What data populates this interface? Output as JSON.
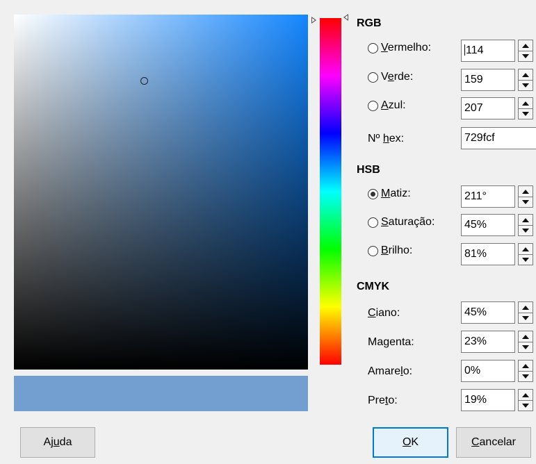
{
  "color": {
    "current_hex": "#729fcf",
    "field_base_hue_hex": "#1486ff",
    "saturation_fraction": 0.45,
    "brightness_fraction": 0.81,
    "hue_degrees": 211
  },
  "rgb": {
    "heading": "RGB",
    "rows": [
      {
        "label_prefix": "",
        "label_access": "V",
        "label_rest": "ermelho:",
        "value": "114",
        "selected": false
      },
      {
        "label_prefix": "V",
        "label_access": "e",
        "label_rest": "rde:",
        "value": "159",
        "selected": false
      },
      {
        "label_prefix": "",
        "label_access": "A",
        "label_rest": "zul:",
        "value": "207",
        "selected": false
      }
    ],
    "hex": {
      "label_prefix": "Nº ",
      "label_access": "h",
      "label_rest": "ex:",
      "value": "729fcf"
    }
  },
  "hsb": {
    "heading": "HSB",
    "rows": [
      {
        "label_prefix": "",
        "label_access": "M",
        "label_rest": "atiz:",
        "value": "211°",
        "selected": true
      },
      {
        "label_prefix": "",
        "label_access": "S",
        "label_rest": "aturação:",
        "value": "45%",
        "selected": false
      },
      {
        "label_prefix": "",
        "label_access": "B",
        "label_rest": "rilho:",
        "value": "81%",
        "selected": false
      }
    ]
  },
  "cmyk": {
    "heading": "CMYK",
    "rows": [
      {
        "label_prefix": "",
        "label_access": "C",
        "label_rest": "iano:",
        "value": "45%"
      },
      {
        "label_prefix": "Ma",
        "label_access": "g",
        "label_rest": "enta:",
        "value": "23%"
      },
      {
        "label_prefix": "Amare",
        "label_access": "l",
        "label_rest": "o:",
        "value": "0%"
      },
      {
        "label_prefix": "Pre",
        "label_access": "t",
        "label_rest": "o:",
        "value": "19%"
      }
    ]
  },
  "buttons": {
    "help": {
      "prefix": "Aj",
      "access": "u",
      "rest": "da"
    },
    "ok": {
      "prefix": "",
      "access": "O",
      "rest": "K"
    },
    "cancel": {
      "prefix": "",
      "access": "C",
      "rest": "ancelar"
    }
  }
}
